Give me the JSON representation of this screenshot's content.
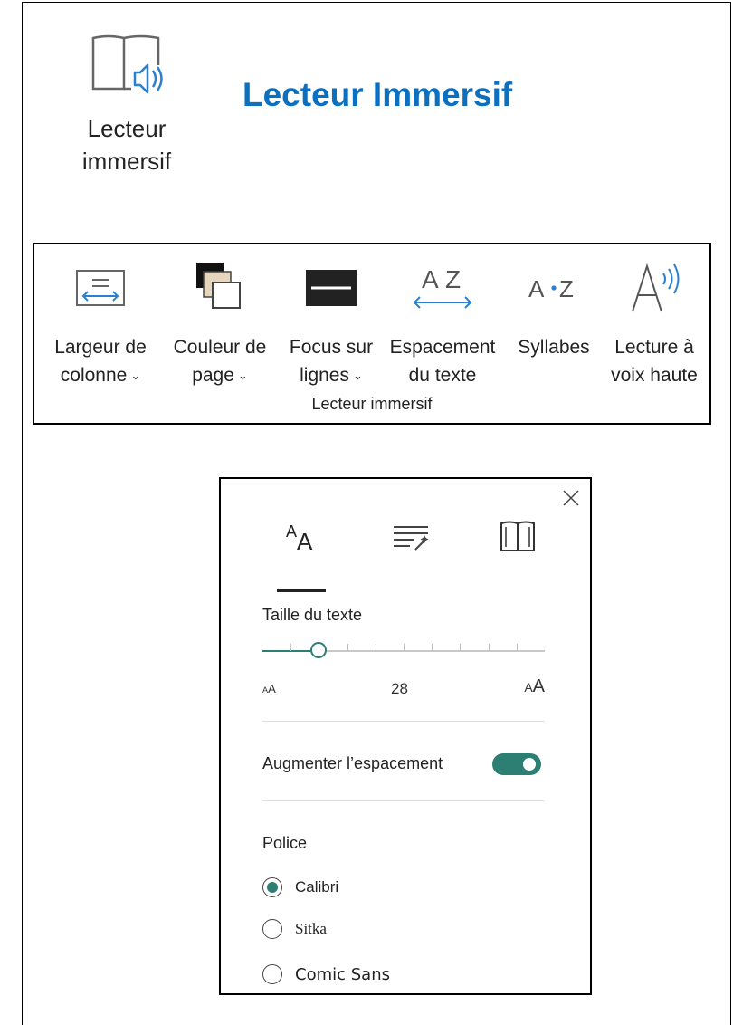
{
  "header": {
    "button_label_line1": "Lecteur",
    "button_label_line2": "immersif",
    "title": "Lecteur Immersif"
  },
  "ribbon": {
    "group_label": "Lecteur immersif",
    "items": [
      {
        "line1": "Largeur de",
        "line2": "colonne",
        "dropdown": true,
        "icon": "column-width-icon"
      },
      {
        "line1": "Couleur de",
        "line2": "page",
        "dropdown": true,
        "icon": "page-color-icon"
      },
      {
        "line1": "Focus sur",
        "line2": "lignes",
        "dropdown": true,
        "icon": "line-focus-icon"
      },
      {
        "line1": "Espacement",
        "line2": "du texte",
        "dropdown": false,
        "icon": "text-spacing-icon"
      },
      {
        "line1": "Syllabes",
        "line2": "",
        "dropdown": false,
        "icon": "syllables-icon"
      },
      {
        "line1": "Lecture à",
        "line2": "voix haute",
        "dropdown": false,
        "icon": "read-aloud-icon"
      }
    ],
    "chevron": "⌄"
  },
  "panel": {
    "tabs": [
      {
        "name": "text-options",
        "icon": "text-size-icon",
        "selected": true
      },
      {
        "name": "grammar-options",
        "icon": "grammar-magic-icon",
        "selected": false
      },
      {
        "name": "reading-preferences",
        "icon": "book-icon",
        "selected": false
      }
    ],
    "text_size": {
      "label": "Taille du texte",
      "value": "28",
      "small_glyph": "AA",
      "large_glyph": "AA",
      "level": 0.2,
      "steps": 9
    },
    "spacing": {
      "label": "Augmenter l’espacement",
      "on": true
    },
    "font": {
      "label": "Police",
      "options": [
        "Calibri",
        "Sitka",
        "Comic Sans"
      ],
      "selected": "Calibri"
    }
  },
  "colors": {
    "title_blue": "#0c6fc0",
    "accent_teal": "#2e7f73",
    "icon_blue": "#2a7fd0"
  }
}
